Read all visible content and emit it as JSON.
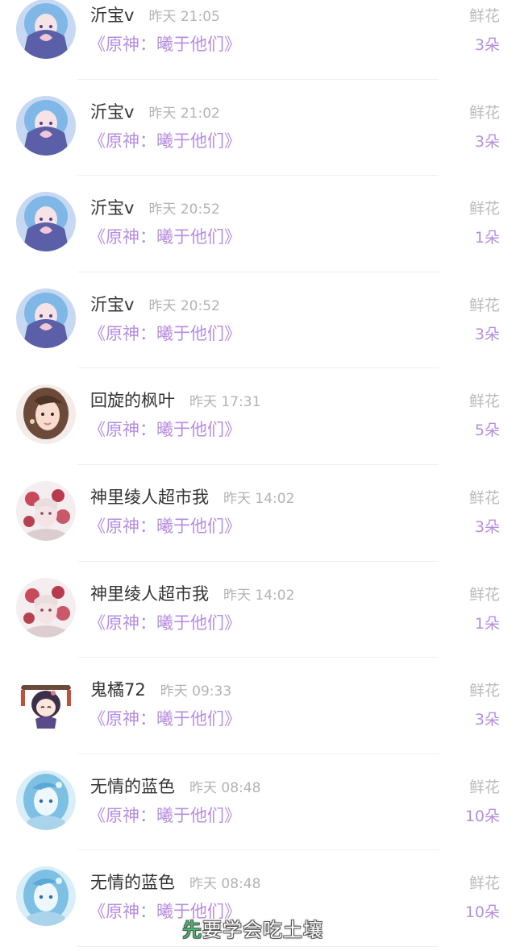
{
  "colors": {
    "name": "#333333",
    "time": "#b3b3b3",
    "accent": "#b58ee0",
    "gift": "#bbbbbb"
  },
  "records": [
    {
      "avatar": "avatar-blue-hair-heart-hands",
      "name": "沂宝v",
      "time": "昨天 21:05",
      "book": "《原神：曦于他们》",
      "gift": "鲜花",
      "count": "3朵"
    },
    {
      "avatar": "avatar-blue-hair-heart-hands",
      "name": "沂宝v",
      "time": "昨天 21:02",
      "book": "《原神：曦于他们》",
      "gift": "鲜花",
      "count": "3朵"
    },
    {
      "avatar": "avatar-blue-hair-heart-hands",
      "name": "沂宝v",
      "time": "昨天 20:52",
      "book": "《原神：曦于他们》",
      "gift": "鲜花",
      "count": "1朵"
    },
    {
      "avatar": "avatar-blue-hair-heart-hands",
      "name": "沂宝v",
      "time": "昨天 20:52",
      "book": "《原神：曦于他们》",
      "gift": "鲜花",
      "count": "3朵"
    },
    {
      "avatar": "avatar-brown-hair-girl",
      "name": "回旋的枫叶",
      "time": "昨天 17:31",
      "book": "《原神：曦于他们》",
      "gift": "鲜花",
      "count": "5朵"
    },
    {
      "avatar": "avatar-red-flowers-girl",
      "name": "神里绫人超市我",
      "time": "昨天 14:02",
      "book": "《原神：曦于他们》",
      "gift": "鲜花",
      "count": "3朵"
    },
    {
      "avatar": "avatar-red-flowers-girl",
      "name": "神里绫人超市我",
      "time": "昨天 14:02",
      "book": "《原神：曦于他们》",
      "gift": "鲜花",
      "count": "1朵"
    },
    {
      "avatar": "avatar-chibi-character",
      "name": "鬼橘72",
      "time": "昨天 09:33",
      "book": "《原神：曦于他们》",
      "gift": "鲜花",
      "count": "3朵"
    },
    {
      "avatar": "avatar-light-blue-hair-girl",
      "name": "无情的蓝色",
      "time": "昨天 08:48",
      "book": "《原神：曦于他们》",
      "gift": "鲜花",
      "count": "10朵"
    },
    {
      "avatar": "avatar-light-blue-hair-girl",
      "name": "无情的蓝色",
      "time": "昨天 08:48",
      "book": "《原神：曦于他们》",
      "gift": "鲜花",
      "count": "10朵"
    }
  ],
  "overlay": {
    "first_char": "先",
    "rest": "要学会吃土壤"
  }
}
